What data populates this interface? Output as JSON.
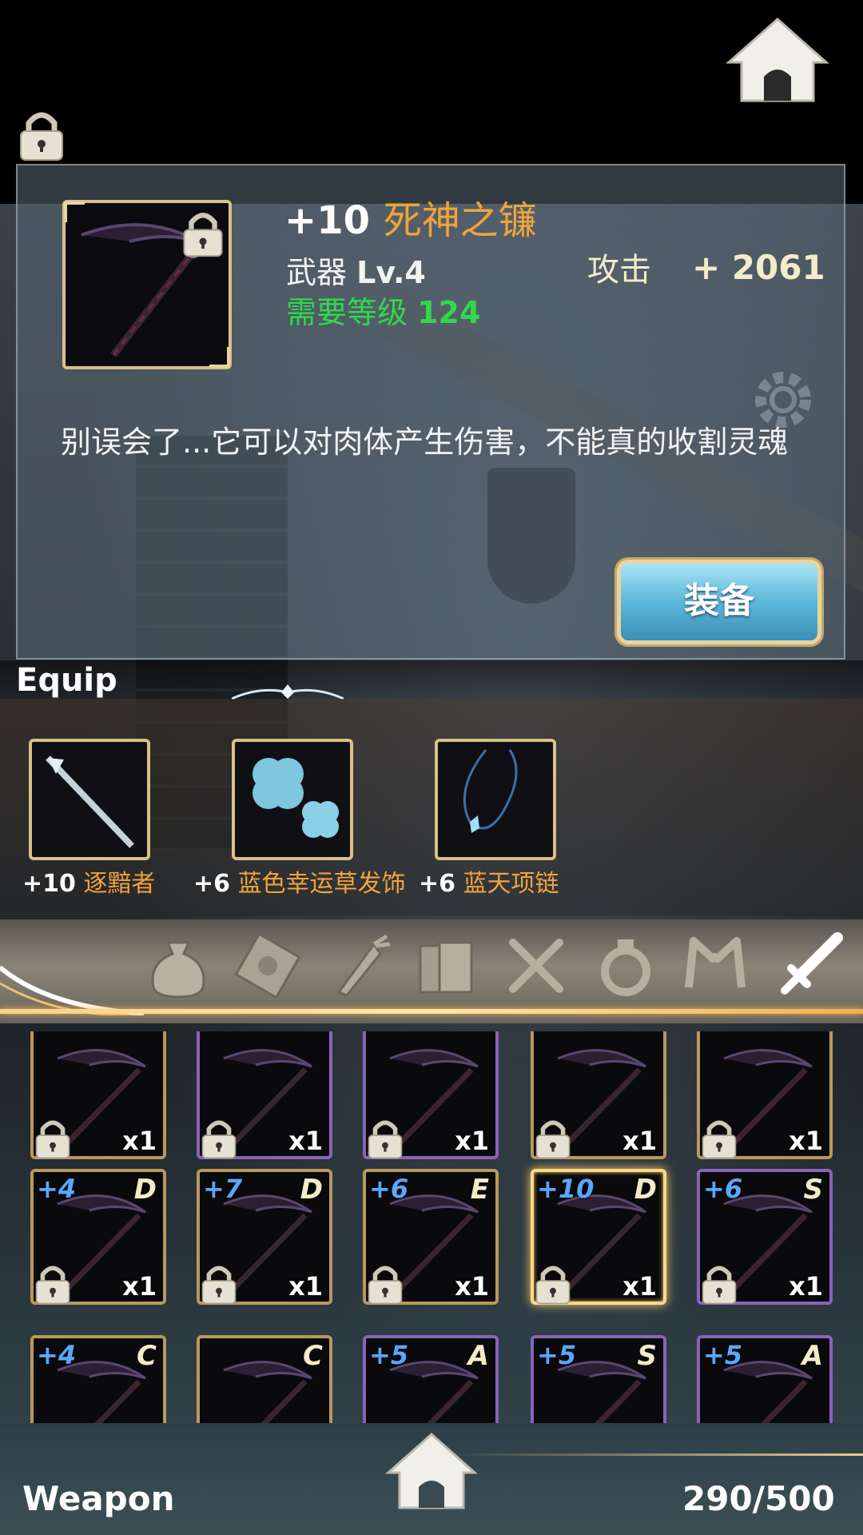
{
  "item": {
    "plus": "+10",
    "name": "死神之镰",
    "type": "武器",
    "level": "Lv.4",
    "required_label": "需要等级",
    "required_level": "124",
    "stat_label": "攻击",
    "stat_value": "+ 2061",
    "description": "别误会了...它可以对肉体产生伤害，不能真的收割灵魂",
    "equip_button": "装备"
  },
  "equip": {
    "title": "Equip",
    "slots": [
      {
        "plus": "+10",
        "name": "逐黯者"
      },
      {
        "plus": "+6",
        "name": "蓝色幸运草发饰"
      },
      {
        "plus": "+6",
        "name": "蓝天项链"
      }
    ]
  },
  "tabs": [
    "bag-icon",
    "scroll-icon",
    "carrot-icon",
    "book-icon",
    "utensils-icon",
    "ring-icon",
    "ears-icon",
    "sword-icon"
  ],
  "inventory": {
    "rows": [
      [
        {
          "lvl": "",
          "grade": "",
          "qty": "x1",
          "rarity": "gold"
        },
        {
          "lvl": "",
          "grade": "",
          "qty": "x1",
          "rarity": "purple"
        },
        {
          "lvl": "",
          "grade": "",
          "qty": "x1",
          "rarity": "purple"
        },
        {
          "lvl": "",
          "grade": "",
          "qty": "x1",
          "rarity": "gold"
        },
        {
          "lvl": "",
          "grade": "",
          "qty": "x1",
          "rarity": "gold"
        }
      ],
      [
        {
          "lvl": "+4",
          "grade": "D",
          "qty": "x1",
          "rarity": "gold"
        },
        {
          "lvl": "+7",
          "grade": "D",
          "qty": "x1",
          "rarity": "gold"
        },
        {
          "lvl": "+6",
          "grade": "E",
          "qty": "x1",
          "rarity": "gold"
        },
        {
          "lvl": "+10",
          "grade": "D",
          "qty": "x1",
          "rarity": "gold"
        },
        {
          "lvl": "+6",
          "grade": "S",
          "qty": "x1",
          "rarity": "purple"
        }
      ],
      [
        {
          "lvl": "+4",
          "grade": "C",
          "qty": "",
          "rarity": "gold"
        },
        {
          "lvl": "",
          "grade": "C",
          "qty": "",
          "rarity": "gold"
        },
        {
          "lvl": "+5",
          "grade": "A",
          "qty": "",
          "rarity": "purple"
        },
        {
          "lvl": "+5",
          "grade": "S",
          "qty": "",
          "rarity": "purple"
        },
        {
          "lvl": "+5",
          "grade": "A",
          "qty": "",
          "rarity": "purple"
        }
      ]
    ]
  },
  "footer": {
    "category": "Weapon",
    "count": "290/500"
  },
  "colors": {
    "accent_orange": "#f0a43a",
    "required_green": "#31d84a",
    "level_blue": "#5aa7ff",
    "frame_gold": "#d9c08a",
    "frame_purple": "#8a63b8"
  }
}
